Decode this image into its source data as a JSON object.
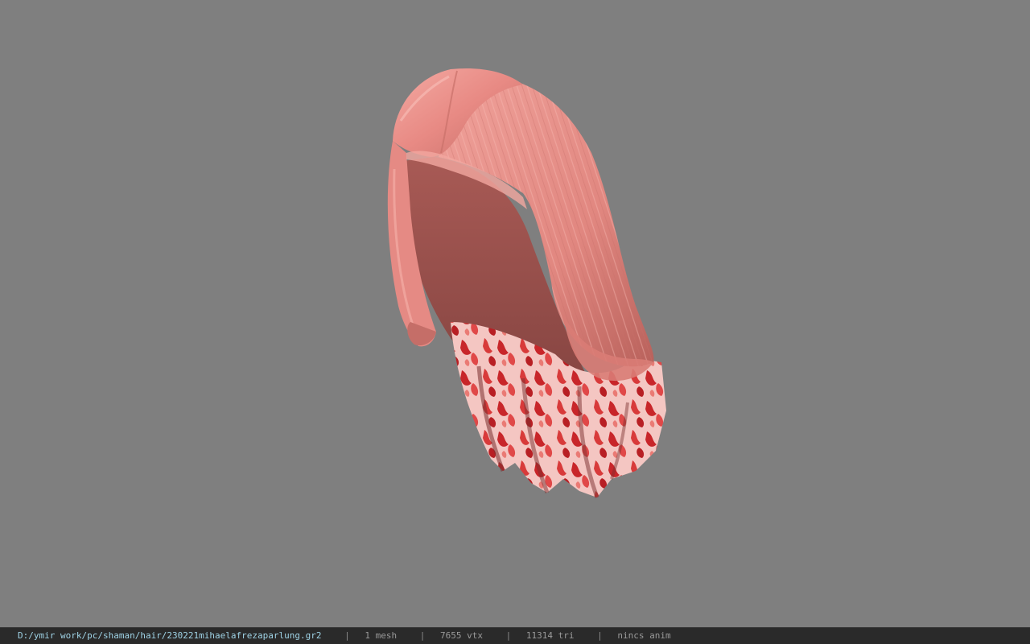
{
  "viewport": {
    "background": "#7f7f7f",
    "model": "hair-mesh",
    "colors": {
      "hair_base": "#e88a84",
      "hair_light": "#f4aaa3",
      "hair_shadow": "#b86560",
      "tips_red": "#c8262a",
      "tips_pale": "#f4c6c2"
    }
  },
  "status_bar": {
    "file_path": "D:/ymir work/pc/shaman/hair/230221mihaelafrezaparlung.gr2",
    "separator": "|",
    "mesh_count": "1 mesh",
    "vertex_count": "7655 vtx",
    "triangle_count": "11314 tri",
    "anim_status": "nincs anim"
  }
}
